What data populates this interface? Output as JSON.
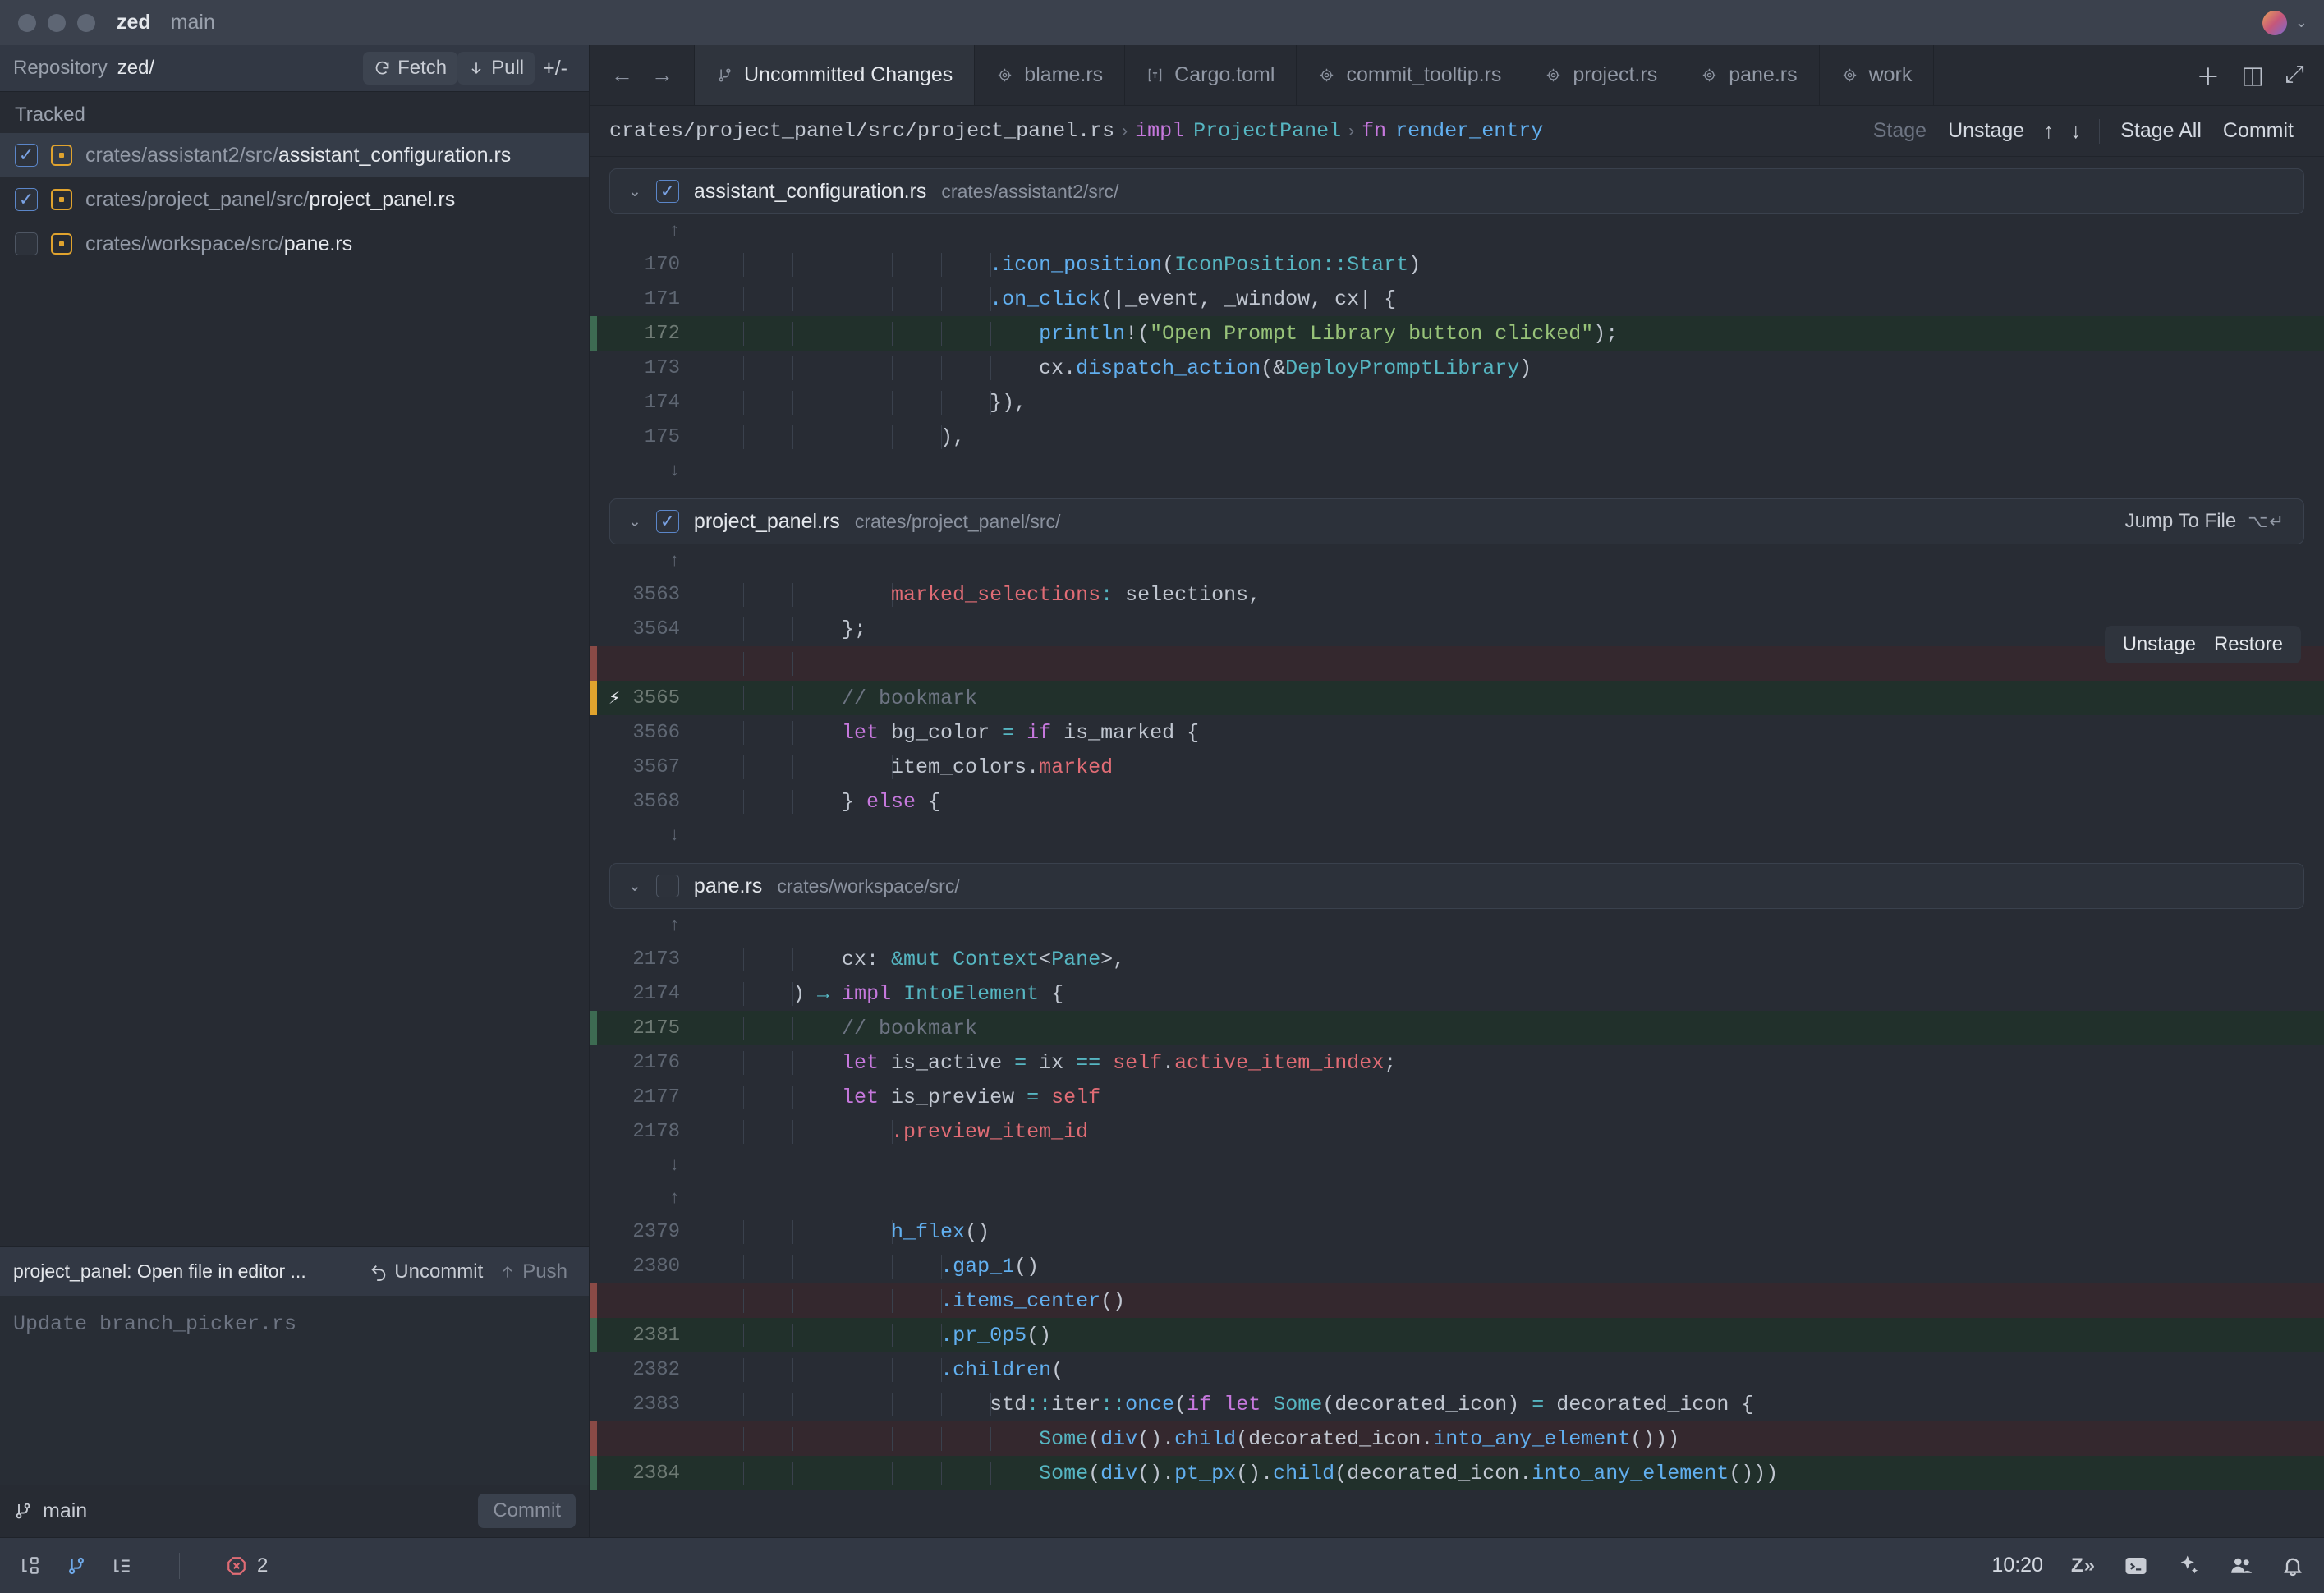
{
  "titlebar": {
    "project": "zed",
    "branch": "main",
    "avatar_name": "user-avatar",
    "chevron": "⌄"
  },
  "git_panel": {
    "header": {
      "repository_label": "Repository",
      "repository_name": "zed/",
      "fetch_label": "Fetch",
      "fetch_icon": "refresh-icon",
      "pull_label": "Pull",
      "pull_icon": "arrow-down-icon",
      "plus_minus_label": "+/-"
    },
    "section_label": "Tracked",
    "files": [
      {
        "dir": "crates/assistant2/src/",
        "name": "assistant_configuration.rs",
        "checked": true,
        "selected": true,
        "status": "modified"
      },
      {
        "dir": "crates/project_panel/src/",
        "name": "project_panel.rs",
        "checked": true,
        "selected": false,
        "status": "modified"
      },
      {
        "dir": "crates/workspace/src/",
        "name": "pane.rs",
        "checked": false,
        "selected": false,
        "status": "modified"
      }
    ],
    "commit_bar": {
      "last_commit": "project_panel: Open file in editor ...",
      "uncommit_label": "Uncommit",
      "uncommit_icon": "undo-icon",
      "push_label": "Push",
      "push_icon": "arrow-up-icon"
    },
    "editor_placeholder": "Update branch_picker.rs",
    "footer": {
      "branch_icon": "git-branch-icon",
      "branch": "main",
      "commit_label": "Commit"
    }
  },
  "tabbar": {
    "back_icon": "arrow-left-icon",
    "forward_icon": "arrow-right-icon",
    "tabs": [
      {
        "label": "Uncommitted Changes",
        "icon": "git-branch-icon",
        "active": true
      },
      {
        "label": "blame.rs",
        "icon": "rust-icon",
        "active": false
      },
      {
        "label": "Cargo.toml",
        "icon": "toml-icon",
        "active": false
      },
      {
        "label": "commit_tooltip.rs",
        "icon": "rust-icon",
        "active": false
      },
      {
        "label": "project.rs",
        "icon": "rust-icon",
        "active": false
      },
      {
        "label": "pane.rs",
        "icon": "rust-icon",
        "active": false
      },
      {
        "label": "work",
        "icon": "rust-icon",
        "active": false
      }
    ],
    "actions": [
      {
        "name": "new-tab-button",
        "glyph": "＋"
      },
      {
        "name": "split-pane-button",
        "glyph": "◫"
      },
      {
        "name": "zoom-pane-button",
        "glyph": "⤢"
      }
    ]
  },
  "toolbar": {
    "breadcrumb": {
      "file_path": "crates/project_panel/src/project_panel.rs",
      "separator": "›",
      "impl_keyword": "impl",
      "impl_type": "ProjectPanel",
      "fn_keyword": "fn",
      "fn_name": "render_entry"
    },
    "actions": {
      "stage_label": "Stage",
      "unstage_label": "Unstage",
      "prev_icon": "arrow-up-icon",
      "next_icon": "arrow-down-icon",
      "stage_all_label": "Stage All",
      "commit_label": "Commit"
    }
  },
  "diff": {
    "hover_actions": {
      "unstage_label": "Unstage",
      "restore_label": "Restore"
    },
    "sections": [
      {
        "name": "assistant_configuration.rs",
        "dir": "crates/assistant2/src/",
        "checked": true,
        "collapse_icon": "chevron-down-icon",
        "jump_label": "",
        "jump_kbd": ""
      },
      {
        "name": "project_panel.rs",
        "dir": "crates/project_panel/src/",
        "checked": true,
        "collapse_icon": "chevron-down-icon",
        "jump_label": "Jump To File",
        "jump_kbd": "⌥↵"
      },
      {
        "name": "pane.rs",
        "dir": "crates/workspace/src/",
        "checked": false,
        "collapse_icon": "chevron-down-icon",
        "jump_label": "",
        "jump_kbd": ""
      }
    ],
    "block_a": {
      "expand_up": "↑",
      "expand_down": "↓",
      "lines": [
        {
          "num": "170",
          "kind": "ctx",
          "indent": 6,
          "tokens": [
            [
              ".icon_position",
              "s-fn"
            ],
            [
              "(",
              "s-pun"
            ],
            [
              "IconPosition",
              "s-type"
            ],
            [
              "::",
              "s-op"
            ],
            [
              "Start",
              "s-type"
            ],
            [
              ")",
              "s-pun"
            ]
          ]
        },
        {
          "num": "171",
          "kind": "ctx",
          "indent": 6,
          "tokens": [
            [
              ".on_click",
              "s-fn"
            ],
            [
              "(|_event, _window, cx| {",
              "s-pun"
            ]
          ]
        },
        {
          "num": "172",
          "kind": "add",
          "indent": 7,
          "tokens": [
            [
              "println",
              "s-mac"
            ],
            [
              "!(",
              "s-pun"
            ],
            [
              "\"Open Prompt Library button clicked\"",
              "s-str"
            ],
            [
              ");",
              "s-pun"
            ]
          ]
        },
        {
          "num": "173",
          "kind": "ctx",
          "indent": 7,
          "tokens": [
            [
              "cx.",
              "s-pun"
            ],
            [
              "dispatch_action",
              "s-fn"
            ],
            [
              "(&",
              "s-pun"
            ],
            [
              "DeployPromptLibrary",
              "s-type"
            ],
            [
              ")",
              "s-pun"
            ]
          ]
        },
        {
          "num": "174",
          "kind": "ctx",
          "indent": 6,
          "tokens": [
            [
              "}),",
              "s-pun"
            ]
          ]
        },
        {
          "num": "175",
          "kind": "ctx",
          "indent": 5,
          "tokens": [
            [
              "),",
              "s-pun"
            ]
          ]
        }
      ]
    },
    "block_b": {
      "expand_up": "↑",
      "expand_down": "↓",
      "lines": [
        {
          "num": "3563",
          "kind": "ctx",
          "indent": 4,
          "tokens": [
            [
              "marked_selections",
              "s-var"
            ],
            [
              ": ",
              "s-op"
            ],
            [
              "selections,",
              "s-pun"
            ]
          ]
        },
        {
          "num": "3564",
          "kind": "ctx",
          "indent": 3,
          "tokens": [
            [
              "};",
              "s-pun"
            ]
          ]
        },
        {
          "num": "",
          "kind": "del",
          "indent": 3,
          "tokens": [
            [
              "",
              "s-pun"
            ]
          ]
        },
        {
          "num": "3565",
          "kind": "add",
          "indent": 3,
          "bolt": true,
          "tokens": [
            [
              "// bookmark",
              "s-cmt"
            ]
          ]
        },
        {
          "num": "3566",
          "kind": "ctx",
          "indent": 3,
          "tokens": [
            [
              "let",
              "s-kw"
            ],
            [
              " bg_color ",
              "s-pun"
            ],
            [
              "=",
              "s-op"
            ],
            [
              " ",
              "s-pun"
            ],
            [
              "if",
              "s-kw"
            ],
            [
              " is_marked {",
              "s-pun"
            ]
          ]
        },
        {
          "num": "3567",
          "kind": "ctx",
          "indent": 4,
          "tokens": [
            [
              "item_colors.",
              "s-pun"
            ],
            [
              "marked",
              "s-var"
            ]
          ]
        },
        {
          "num": "3568",
          "kind": "ctx",
          "indent": 3,
          "tokens": [
            [
              "} ",
              "s-pun"
            ],
            [
              "else",
              "s-kw"
            ],
            [
              " {",
              "s-pun"
            ]
          ]
        }
      ]
    },
    "block_c": {
      "expand_up": "↑",
      "expand_down": "↓",
      "lines": [
        {
          "num": "2173",
          "kind": "ctx",
          "indent": 3,
          "tokens": [
            [
              "cx: ",
              "s-pun"
            ],
            [
              "&mut",
              "s-type"
            ],
            [
              " ",
              "s-pun"
            ],
            [
              "Context",
              "s-type"
            ],
            [
              "<",
              "s-pun"
            ],
            [
              "Pane",
              "s-type"
            ],
            [
              ">,",
              "s-pun"
            ]
          ]
        },
        {
          "num": "2174",
          "kind": "ctx",
          "indent": 2,
          "tokens": [
            [
              ") ",
              "s-pun"
            ],
            [
              "→",
              "s-op"
            ],
            [
              " ",
              "s-pun"
            ],
            [
              "impl",
              "s-kw"
            ],
            [
              " ",
              "s-pun"
            ],
            [
              "IntoElement",
              "s-type"
            ],
            [
              " {",
              "s-pun"
            ]
          ]
        },
        {
          "num": "2175",
          "kind": "add",
          "indent": 3,
          "tokens": [
            [
              "// bookmark",
              "s-cmt"
            ]
          ]
        },
        {
          "num": "2176",
          "kind": "ctx",
          "indent": 3,
          "tokens": [
            [
              "let",
              "s-kw"
            ],
            [
              " is_active ",
              "s-pun"
            ],
            [
              "=",
              "s-op"
            ],
            [
              " ix ",
              "s-pun"
            ],
            [
              "==",
              "s-op"
            ],
            [
              " ",
              "s-pun"
            ],
            [
              "self",
              "s-var"
            ],
            [
              ".",
              "s-pun"
            ],
            [
              "active_item_index",
              "s-var"
            ],
            [
              ";",
              "s-pun"
            ]
          ]
        },
        {
          "num": "2177",
          "kind": "ctx",
          "indent": 3,
          "tokens": [
            [
              "let",
              "s-kw"
            ],
            [
              " is_preview ",
              "s-pun"
            ],
            [
              "=",
              "s-op"
            ],
            [
              " ",
              "s-pun"
            ],
            [
              "self",
              "s-var"
            ]
          ]
        },
        {
          "num": "2178",
          "kind": "ctx",
          "indent": 4,
          "tokens": [
            [
              ".preview_item_id",
              "s-var"
            ]
          ]
        }
      ]
    },
    "block_d": {
      "expand_up": "↑",
      "lines": [
        {
          "num": "2379",
          "kind": "ctx",
          "indent": 4,
          "tokens": [
            [
              "h_flex",
              "s-fn"
            ],
            [
              "()",
              "s-pun"
            ]
          ]
        },
        {
          "num": "2380",
          "kind": "ctx",
          "indent": 5,
          "tokens": [
            [
              ".gap_1",
              "s-fn"
            ],
            [
              "()",
              "s-pun"
            ]
          ]
        },
        {
          "num": "",
          "kind": "del",
          "indent": 5,
          "tokens": [
            [
              ".items_center",
              "s-fn"
            ],
            [
              "()",
              "s-pun"
            ]
          ]
        },
        {
          "num": "2381",
          "kind": "add",
          "indent": 5,
          "tokens": [
            [
              ".pr_0p5",
              "s-fn"
            ],
            [
              "()",
              "s-pun"
            ]
          ]
        },
        {
          "num": "2382",
          "kind": "ctx",
          "indent": 5,
          "tokens": [
            [
              ".children",
              "s-fn"
            ],
            [
              "(",
              "s-pun"
            ]
          ]
        },
        {
          "num": "2383",
          "kind": "ctx",
          "indent": 6,
          "tokens": [
            [
              "std",
              "s-pun"
            ],
            [
              "::",
              "s-op"
            ],
            [
              "iter",
              "s-pun"
            ],
            [
              "::",
              "s-op"
            ],
            [
              "once",
              "s-fn"
            ],
            [
              "(",
              "s-pun"
            ],
            [
              "if",
              "s-kw"
            ],
            [
              " ",
              "s-pun"
            ],
            [
              "let",
              "s-kw"
            ],
            [
              " ",
              "s-pun"
            ],
            [
              "Some",
              "s-type"
            ],
            [
              "(decorated_icon) ",
              "s-pun"
            ],
            [
              "=",
              "s-op"
            ],
            [
              " decorated_icon {",
              "s-pun"
            ]
          ]
        },
        {
          "num": "",
          "kind": "del",
          "indent": 7,
          "tokens": [
            [
              "Some",
              "s-type"
            ],
            [
              "(",
              "s-pun"
            ],
            [
              "div",
              "s-fn"
            ],
            [
              "().",
              "s-pun"
            ],
            [
              "child",
              "s-fn"
            ],
            [
              "(decorated_icon.",
              "s-pun"
            ],
            [
              "into_any_element",
              "s-fn"
            ],
            [
              "()))",
              "s-pun"
            ]
          ]
        },
        {
          "num": "2384",
          "kind": "add",
          "indent": 7,
          "tokens": [
            [
              "Some",
              "s-type"
            ],
            [
              "(",
              "s-pun"
            ],
            [
              "div",
              "s-fn"
            ],
            [
              "().",
              "s-pun"
            ],
            [
              "pt_px",
              "s-fn"
            ],
            [
              "().",
              "s-pun"
            ],
            [
              "child",
              "s-fn"
            ],
            [
              "(decorated_icon.",
              "s-pun"
            ],
            [
              "into_any_element",
              "s-fn"
            ],
            [
              "()))",
              "s-pun"
            ]
          ]
        }
      ]
    }
  },
  "statusbar": {
    "left_icons": [
      {
        "name": "project-panel-icon",
        "active": false
      },
      {
        "name": "git-panel-icon",
        "active": true
      },
      {
        "name": "outline-panel-icon",
        "active": false
      }
    ],
    "diagnostics_icon": "error-icon",
    "diagnostics_count": "2",
    "time": "10:20",
    "right_icons": [
      {
        "name": "zed-predict-icon",
        "label": "Z»"
      },
      {
        "name": "terminal-icon",
        "label": ">_"
      },
      {
        "name": "assistant-sparkle-icon",
        "label": "✦"
      },
      {
        "name": "collab-people-icon",
        "label": "people"
      },
      {
        "name": "notifications-bell-icon",
        "label": "bell"
      }
    ]
  }
}
